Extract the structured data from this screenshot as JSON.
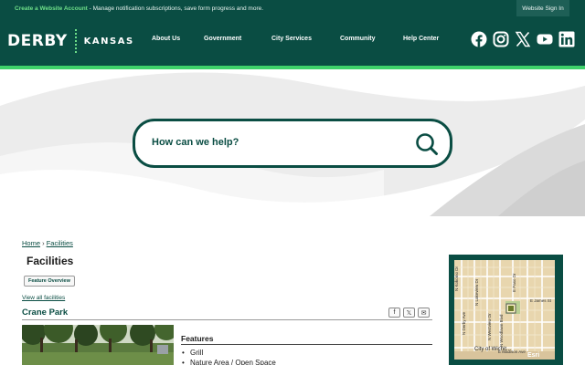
{
  "topbar": {
    "account_link": "Create a Website Account",
    "account_message": " - Manage notification subscriptions, save form progress and more.",
    "sign_in": "Website Sign In"
  },
  "header": {
    "logo_primary": "DERBY",
    "logo_secondary": "KANSAS",
    "nav": [
      "About Us",
      "Government",
      "City Services",
      "Community",
      "Help Center"
    ],
    "social_icons": [
      "facebook-icon",
      "instagram-icon",
      "x-icon",
      "youtube-icon",
      "linkedin-icon"
    ]
  },
  "search": {
    "placeholder": "How can we help?"
  },
  "breadcrumb": {
    "home": "Home",
    "separator": " › ",
    "current": "Facilities"
  },
  "page": {
    "title": "Facilities",
    "feature_overview": "Feature Overview",
    "view_all": "View all facilities",
    "facility_name": "Crane Park",
    "share_icons": [
      "facebook-share-icon",
      "x-share-icon",
      "email-share-icon"
    ],
    "share_glyphs": [
      "f",
      "𝕏",
      "✉"
    ],
    "features_heading": "Features",
    "features": [
      "Grill",
      "Nature Area / Open Space"
    ]
  },
  "map": {
    "streets": [
      "N Kokomo Dr",
      "N Derby Ave",
      "N Lakeview Dr",
      "N Westview Dr",
      "N Woodlawn Blvd",
      "E Paso Dr",
      "E James St",
      "E Madison Ave"
    ],
    "city_label": "City of Wichit...",
    "attribution": "Esri"
  },
  "colors": {
    "brand_dark": "#0a4d43",
    "brand_green": "#3ed16a"
  }
}
